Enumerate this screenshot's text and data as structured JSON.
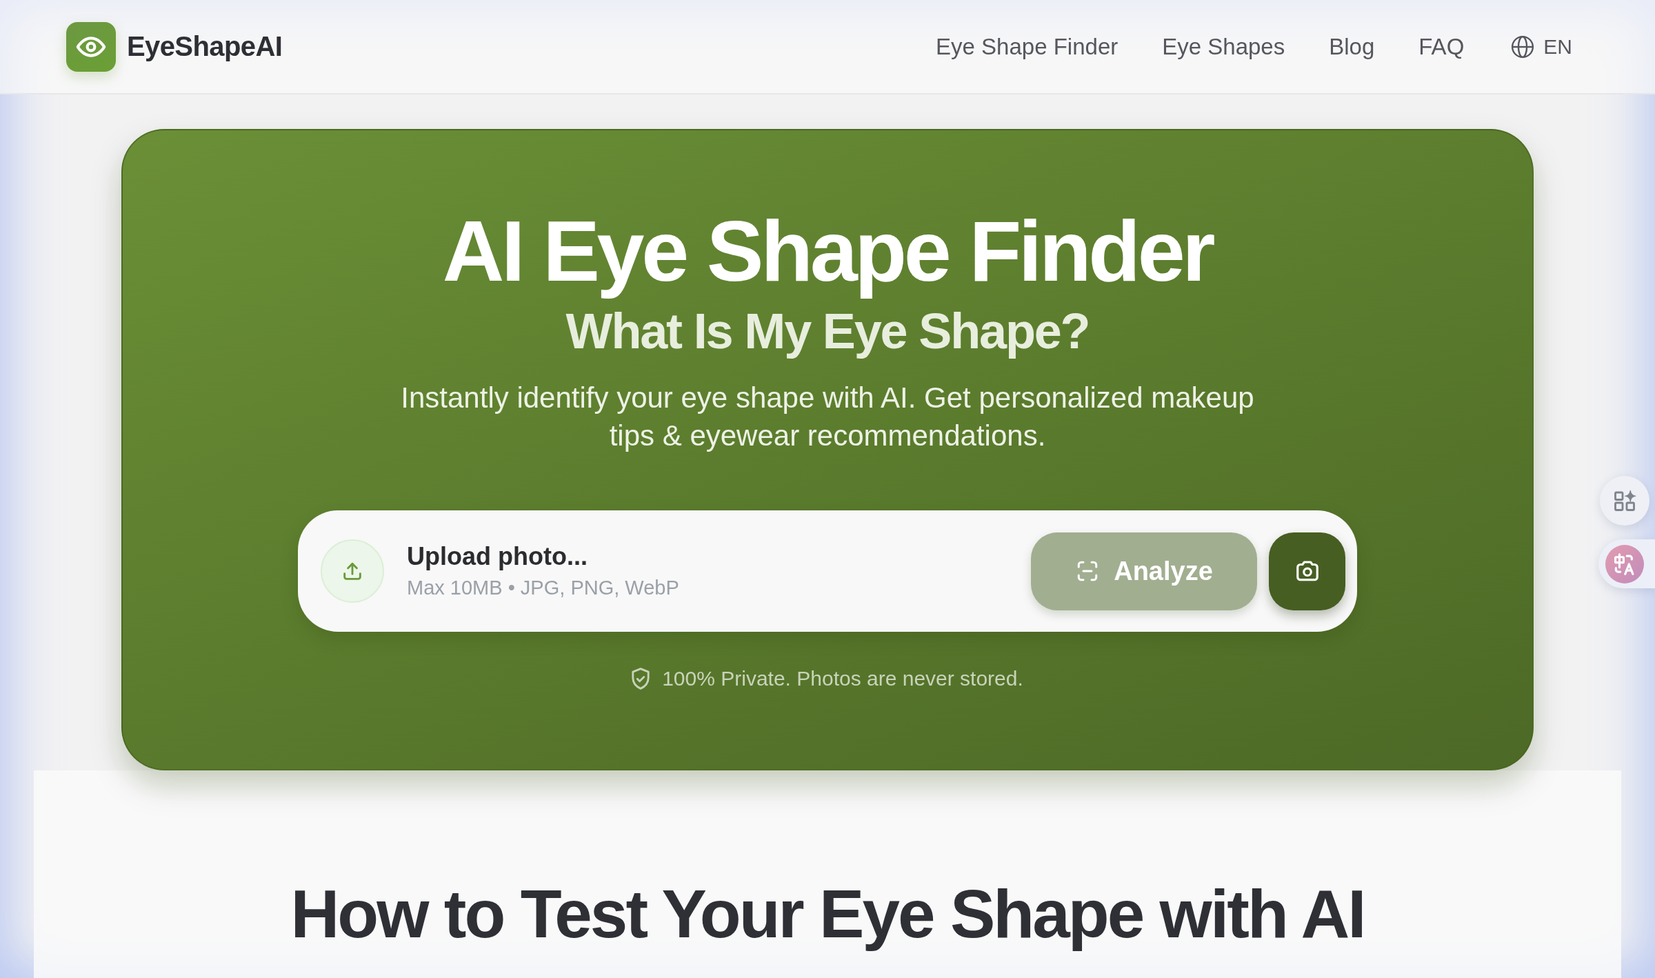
{
  "header": {
    "brand": "EyeShapeAI",
    "nav": [
      "Eye Shape Finder",
      "Eye Shapes",
      "Blog",
      "FAQ"
    ],
    "language": "EN"
  },
  "hero": {
    "title": "AI Eye Shape Finder",
    "subtitle": "What Is My Eye Shape?",
    "description": "Instantly identify your eye shape with AI. Get personalized makeup tips & eyewear recommendations.",
    "upload": {
      "label": "Upload photo...",
      "hint": "Max 10MB • JPG, PNG, WebP"
    },
    "analyze_button": {
      "label": "Analyze",
      "disabled": true
    },
    "privacy_note": "100% Private. Photos are never stored."
  },
  "how_to": {
    "heading": "How to Test Your Eye Shape with AI"
  },
  "side_tools": [
    {
      "kind": "apps"
    },
    {
      "kind": "translate"
    }
  ]
}
